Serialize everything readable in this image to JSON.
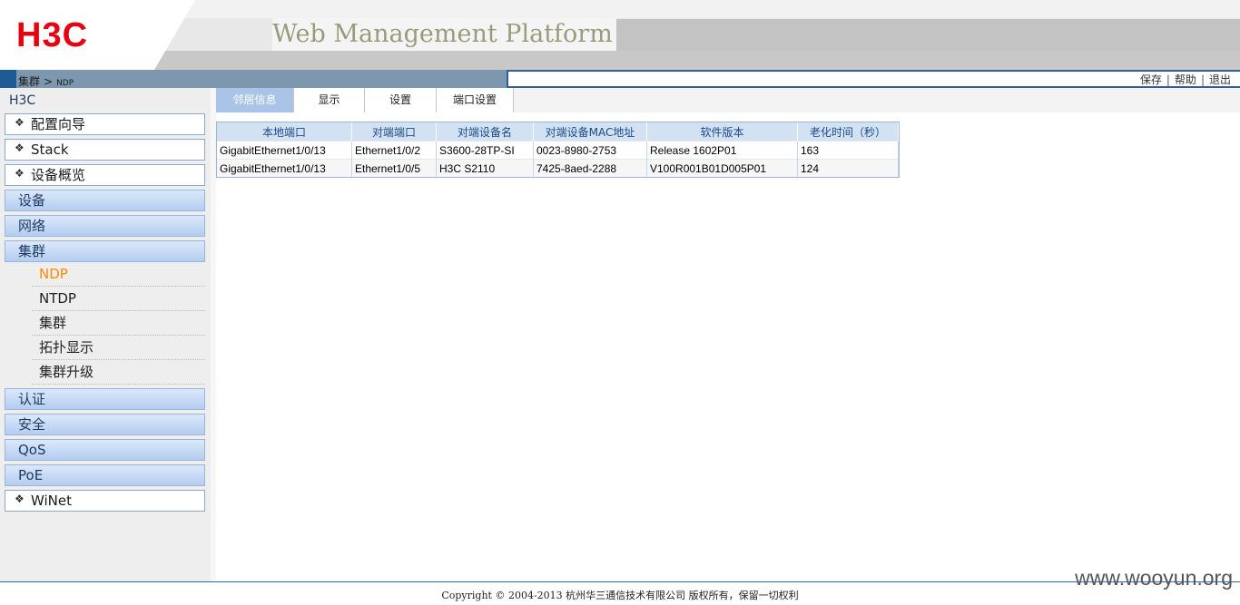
{
  "header": {
    "logo": "H3C",
    "platform_title": "Web Management Platform"
  },
  "breadcrumb": {
    "parent": "集群",
    "separator": ">",
    "current": "NDP"
  },
  "top_links": {
    "save": "保存",
    "help": "帮助",
    "logout": "退出",
    "separator": "|"
  },
  "sidebar": {
    "root": "H3C",
    "items": [
      {
        "label": "配置向导"
      },
      {
        "label": "Stack"
      },
      {
        "label": "设备概览"
      },
      {
        "label": "设备"
      },
      {
        "label": "网络"
      },
      {
        "label": "集群"
      },
      {
        "label": "认证"
      },
      {
        "label": "安全"
      },
      {
        "label": "QoS"
      },
      {
        "label": "PoE"
      },
      {
        "label": "WiNet"
      }
    ],
    "cluster_sub": [
      {
        "label": "NDP"
      },
      {
        "label": "NTDP"
      },
      {
        "label": "集群"
      },
      {
        "label": "拓扑显示"
      },
      {
        "label": "集群升级"
      }
    ],
    "bullet": "❖"
  },
  "tabs": [
    {
      "label": "邻居信息"
    },
    {
      "label": "显示"
    },
    {
      "label": "设置"
    },
    {
      "label": "端口设置"
    }
  ],
  "table": {
    "headers": [
      "本地端口",
      "对端端口",
      "对端设备名",
      "对端设备MAC地址",
      "软件版本",
      "老化时间（秒）"
    ],
    "rows": [
      [
        "GigabitEthernet1/0/13",
        "Ethernet1/0/2",
        "S3600-28TP-SI",
        "0023-8980-2753",
        "Release 1602P01",
        "163"
      ],
      [
        "GigabitEthernet1/0/13",
        "Ethernet1/0/5",
        "H3C S2110",
        "7425-8aed-2288",
        "V100R001B01D005P01",
        "124"
      ]
    ]
  },
  "footer": {
    "copyright": "Copyright © 2004-2013 杭州华三通信技术有限公司 版权所有，保留一切权利"
  },
  "watermark": "www.wooyun.org",
  "colors": {
    "logo_red": "#e60012",
    "active_submenu": "#ff8a00",
    "table_header_bg": "#d3e2f3",
    "active_tab_bg": "#a9c4e6"
  }
}
